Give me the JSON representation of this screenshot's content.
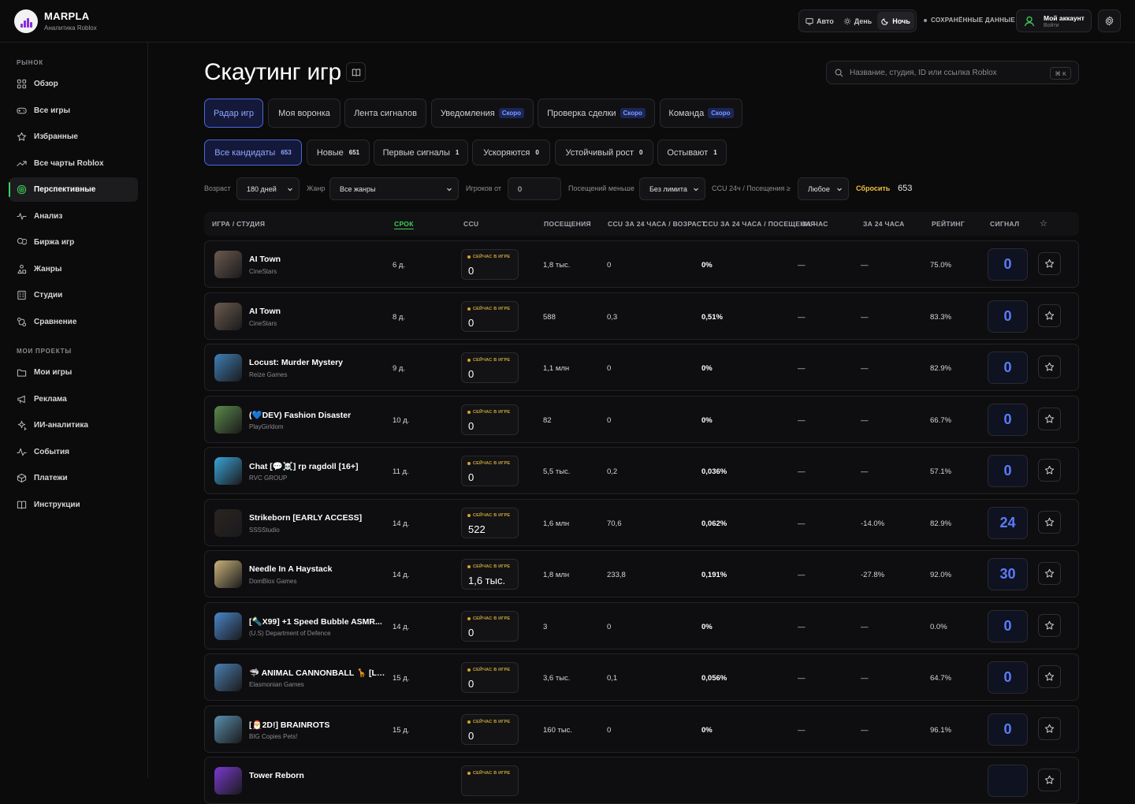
{
  "brand": {
    "name": "MARPLA",
    "subtitle": "Аналитика Roblox"
  },
  "topbar": {
    "theme": [
      {
        "label": "Авто",
        "icon": "monitor-icon"
      },
      {
        "label": "День",
        "icon": "sun-icon"
      },
      {
        "label": "Ночь",
        "icon": "moon-icon",
        "active": true
      }
    ],
    "saved": "СОХРАНЁННЫЕ ДАННЫЕ",
    "account": {
      "title": "Мой аккаунт",
      "subtitle": "Войти"
    }
  },
  "sidebar": {
    "market_title": "РЫНОК",
    "market": [
      {
        "label": "Обзор",
        "icon": "grid-icon"
      },
      {
        "label": "Все игры",
        "icon": "gamepad-icon"
      },
      {
        "label": "Избранные",
        "icon": "star-icon"
      },
      {
        "label": "Все чарты Roblox",
        "icon": "trend-icon"
      },
      {
        "label": "Перспективные",
        "icon": "target-icon",
        "active": true
      },
      {
        "label": "Анализ",
        "icon": "pulse-icon"
      },
      {
        "label": "Биржа игр",
        "icon": "coins-icon"
      },
      {
        "label": "Жанры",
        "icon": "shapes-icon"
      },
      {
        "label": "Студии",
        "icon": "building-icon"
      },
      {
        "label": "Сравнение",
        "icon": "compare-icon"
      }
    ],
    "projects_title": "МОИ ПРОЕКТЫ",
    "projects": [
      {
        "label": "Мои игры",
        "icon": "folder-icon"
      },
      {
        "label": "Реклама",
        "icon": "megaphone-icon"
      },
      {
        "label": "ИИ-аналитика",
        "icon": "sparkle-icon"
      },
      {
        "label": "События",
        "icon": "activity-icon"
      },
      {
        "label": "Платежи",
        "icon": "box-icon"
      },
      {
        "label": "Инструкции",
        "icon": "book-icon"
      }
    ]
  },
  "page": {
    "title": "Скаутинг игр",
    "search_placeholder": "Название, студия, ID или ссылка Roblox",
    "shortcut": "⌘ K"
  },
  "tabs": [
    {
      "label": "Радар игр",
      "active": true
    },
    {
      "label": "Моя воронка"
    },
    {
      "label": "Лента сигналов"
    },
    {
      "label": "Уведомления",
      "badge": "Скоро"
    },
    {
      "label": "Проверка сделки",
      "badge": "Скоро"
    },
    {
      "label": "Команда",
      "badge": "Скоро"
    }
  ],
  "chips": [
    {
      "label": "Все кандидаты",
      "count": "653",
      "active": true
    },
    {
      "label": "Новые",
      "count": "651"
    },
    {
      "label": "Первые сигналы",
      "count": "1"
    },
    {
      "label": "Ускоряются",
      "count": "0"
    },
    {
      "label": "Устойчивый рост",
      "count": "0"
    },
    {
      "label": "Остывают",
      "count": "1"
    }
  ],
  "filters": {
    "age_label": "Возраст",
    "age_value": "180 дней",
    "genre_label": "Жанр",
    "genre_value": "Все жанры",
    "players_label": "Игроков от",
    "players_value": "0",
    "visits_label": "Посещений меньше",
    "visits_value": "Без лимита",
    "ratio_label": "CCU 24ч / Посещения ≥",
    "ratio_value": "Любое",
    "reset": "Сбросить",
    "total": "653"
  },
  "table": {
    "headers": [
      "ИГРА / СТУДИЯ",
      "СРОК",
      "CCU",
      "ПОСЕЩЕНИЯ",
      "CCU ЗА 24 ЧАСА / ВОЗРАСТ",
      "CCU ЗА 24 ЧАСА / ПОСЕЩЕНИЯ",
      "ЗА ЧАС",
      "ЗА 24 ЧАСА",
      "РЕЙТИНГ",
      "СИГНАЛ",
      "☆"
    ],
    "ccu_label": "СЕЙЧАС В ИГРЕ",
    "rows": [
      {
        "name": "AI Town",
        "studio": "CineStars",
        "age": "6 д.",
        "ccu": "0",
        "visits": "1,8 тыс.",
        "ccu_age": "0",
        "ccu_visits": "0%",
        "hour": "—",
        "day": "—",
        "rating": "75.0%",
        "signal": "0",
        "thumb": "#6b5a4e"
      },
      {
        "name": "AI Town",
        "studio": "CineStars",
        "age": "8 д.",
        "ccu": "0",
        "visits": "588",
        "ccu_age": "0,3",
        "ccu_visits": "0,51%",
        "hour": "—",
        "day": "—",
        "rating": "83.3%",
        "signal": "0",
        "thumb": "#6b5a4e"
      },
      {
        "name": "Locust: Murder Mystery",
        "studio": "Reize Games",
        "age": "9 д.",
        "ccu": "0",
        "visits": "1,1 млн",
        "ccu_age": "0",
        "ccu_visits": "0%",
        "hour": "—",
        "day": "—",
        "rating": "82.9%",
        "signal": "0",
        "thumb": "#3f7fb5"
      },
      {
        "name": "(💙DEV) Fashion Disaster",
        "studio": "PlayGirldom",
        "age": "10 д.",
        "ccu": "0",
        "visits": "82",
        "ccu_age": "0",
        "ccu_visits": "0%",
        "hour": "—",
        "day": "—",
        "rating": "66.7%",
        "signal": "0",
        "thumb": "#5b8a4a"
      },
      {
        "name": "Chat [💬☠️] rp ragdoll [16+]",
        "studio": "RVC GROUP",
        "age": "11 д.",
        "ccu": "0",
        "visits": "5,5 тыс.",
        "ccu_age": "0,2",
        "ccu_visits": "0,036%",
        "hour": "—",
        "day": "—",
        "rating": "57.1%",
        "signal": "0",
        "thumb": "#3aa5d8"
      },
      {
        "name": "Strikeborn [EARLY ACCESS]",
        "studio": "SSSStudio",
        "age": "14 д.",
        "ccu": "522",
        "visits": "1,6 млн",
        "ccu_age": "70,6",
        "ccu_visits": "0,062%",
        "hour": "—",
        "day": "-14.0%",
        "rating": "82.9%",
        "signal": "24",
        "thumb": "#2a2420"
      },
      {
        "name": "Needle In A Haystack",
        "studio": "DomBlox Games",
        "age": "14 д.",
        "ccu": "1,6 тыс.",
        "visits": "1,8 млн",
        "ccu_age": "233,8",
        "ccu_visits": "0,191%",
        "hour": "—",
        "day": "-27.8%",
        "rating": "92.0%",
        "signal": "30",
        "thumb": "#c9b37a"
      },
      {
        "name": "[🔦X99] +1 Speed Bubble ASMR...",
        "studio": "(U.S) Department of Defence",
        "age": "14 д.",
        "ccu": "0",
        "visits": "3",
        "ccu_age": "0",
        "ccu_visits": "0%",
        "hour": "—",
        "day": "—",
        "rating": "0.0%",
        "signal": "0",
        "thumb": "#4a86c8"
      },
      {
        "name": "🦈 ANIMAL CANNONBALL 🦒 [LA...",
        "studio": "Elasmonian Games",
        "age": "15 д.",
        "ccu": "0",
        "visits": "3,6 тыс.",
        "ccu_age": "0,1",
        "ccu_visits": "0,056%",
        "hour": "—",
        "day": "—",
        "rating": "64.7%",
        "signal": "0",
        "thumb": "#4b7fb0"
      },
      {
        "name": "[🎅2D!] BRAINROTS",
        "studio": "BIG Copies Pets!",
        "age": "15 д.",
        "ccu": "0",
        "visits": "160 тыс.",
        "ccu_age": "0",
        "ccu_visits": "0%",
        "hour": "—",
        "day": "—",
        "rating": "96.1%",
        "signal": "0",
        "thumb": "#5a8fae"
      },
      {
        "name": "Tower Reborn",
        "studio": "",
        "age": "",
        "ccu": "",
        "visits": "",
        "ccu_age": "",
        "ccu_visits": "",
        "hour": "",
        "day": "",
        "rating": "",
        "signal": "",
        "thumb": "#7a3ad0"
      }
    ]
  }
}
